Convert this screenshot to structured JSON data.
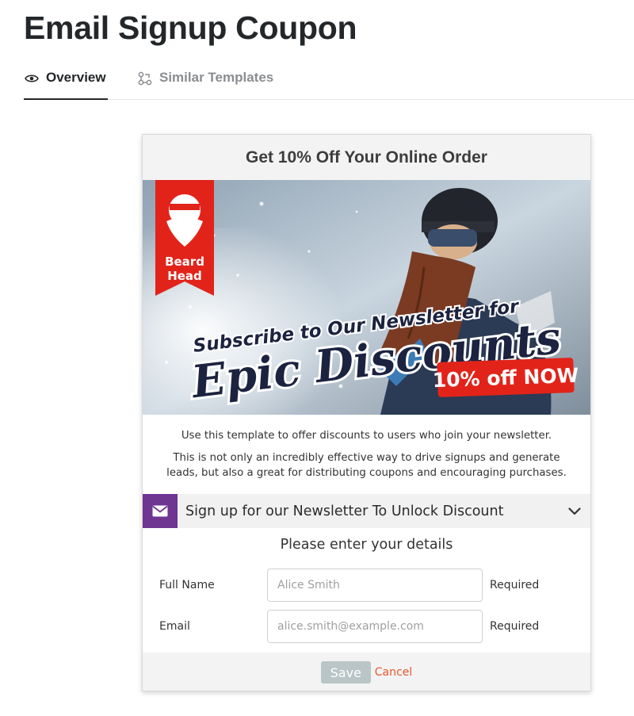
{
  "page": {
    "title": "Email Signup Coupon"
  },
  "tabs": [
    {
      "label": "Overview",
      "icon": "eye-icon",
      "active": true
    },
    {
      "label": "Similar Templates",
      "icon": "templates-icon",
      "active": false
    }
  ],
  "card": {
    "header": "Get 10% Off Your Online Order",
    "banner": {
      "logo_line1": "Beard",
      "logo_line2": "Head",
      "headline_small": "Subscribe to Our Newsletter for",
      "headline_big": "Epic Discounts",
      "badge": "10% off NOW"
    },
    "description": [
      "Use this template to offer discounts to users who join your newsletter.",
      "This is not only an incredibly effective way to drive signups and generate leads, but also a great for distributing coupons and encouraging purchases."
    ],
    "accordion": {
      "title": "Sign up for our Newsletter To Unlock Discount",
      "icon": "envelope-icon",
      "toggle_icon": "chevron-down-icon"
    },
    "form": {
      "title": "Please enter your details",
      "fields": [
        {
          "label": "Full Name",
          "placeholder": "Alice Smith",
          "required": "Required"
        },
        {
          "label": "Email",
          "placeholder": "alice.smith@example.com",
          "required": "Required"
        }
      ],
      "save_label": "Save",
      "cancel_label": "Cancel"
    }
  },
  "colors": {
    "accordion_icon_bg": "#6e3591",
    "cancel": "#e4572e",
    "save_bg": "#b9c5c6",
    "logo_red": "#e2231a"
  }
}
